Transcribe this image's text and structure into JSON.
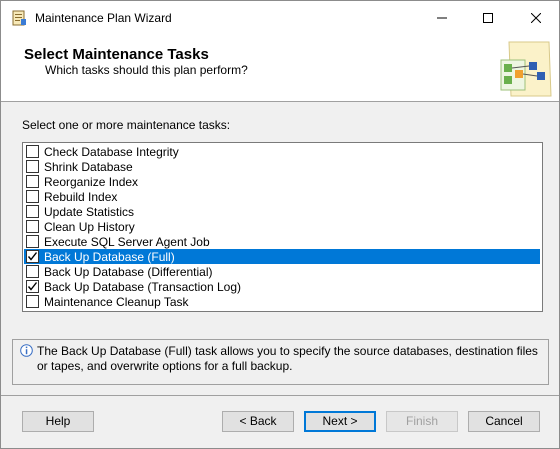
{
  "window": {
    "title": "Maintenance Plan Wizard"
  },
  "header": {
    "title": "Select Maintenance Tasks",
    "subtitle": "Which tasks should this plan perform?"
  },
  "prompt": "Select one or more maintenance tasks:",
  "tasks": [
    {
      "label": "Check Database Integrity",
      "checked": false,
      "selected": false
    },
    {
      "label": "Shrink Database",
      "checked": false,
      "selected": false
    },
    {
      "label": "Reorganize Index",
      "checked": false,
      "selected": false
    },
    {
      "label": "Rebuild Index",
      "checked": false,
      "selected": false
    },
    {
      "label": "Update Statistics",
      "checked": false,
      "selected": false
    },
    {
      "label": "Clean Up History",
      "checked": false,
      "selected": false
    },
    {
      "label": "Execute SQL Server Agent Job",
      "checked": false,
      "selected": false
    },
    {
      "label": "Back Up Database (Full)",
      "checked": true,
      "selected": true
    },
    {
      "label": "Back Up Database (Differential)",
      "checked": false,
      "selected": false
    },
    {
      "label": "Back Up Database (Transaction Log)",
      "checked": true,
      "selected": false
    },
    {
      "label": "Maintenance Cleanup Task",
      "checked": false,
      "selected": false
    }
  ],
  "info": {
    "text": "The Back Up Database (Full) task allows you to specify the source databases, destination files or tapes, and overwrite options for a full backup."
  },
  "buttons": {
    "help": "Help",
    "back": "< Back",
    "next": "Next >",
    "finish": "Finish",
    "cancel": "Cancel"
  },
  "colors": {
    "selection": "#0078d7",
    "dialog_background": "#f0f0f0"
  }
}
